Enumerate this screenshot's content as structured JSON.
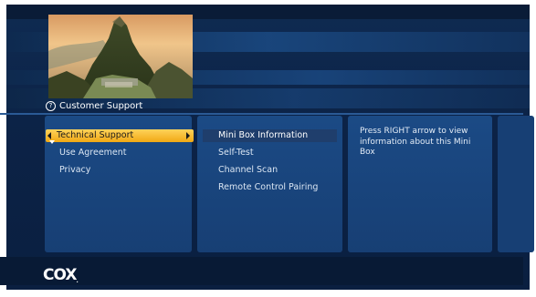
{
  "header": {
    "title": "Customer Support",
    "help_icon": "question-circle-icon"
  },
  "menu": {
    "items": [
      {
        "label": "Technical Support",
        "selected": true
      },
      {
        "label": "Use Agreement",
        "selected": false
      },
      {
        "label": "Privacy",
        "selected": false
      }
    ]
  },
  "submenu": {
    "items": [
      {
        "label": "Mini Box Information",
        "highlighted": true
      },
      {
        "label": "Self-Test",
        "highlighted": false
      },
      {
        "label": "Channel Scan",
        "highlighted": false
      },
      {
        "label": "Remote Control Pairing",
        "highlighted": false
      }
    ]
  },
  "info": {
    "text": "Press RIGHT arrow to view information about this Mini Box"
  },
  "footer": {
    "logo_text": "COX",
    "logo_dot": "."
  },
  "colors": {
    "accent": "#f5b326",
    "panel": "#1b4a85",
    "background": "#0c2347"
  }
}
